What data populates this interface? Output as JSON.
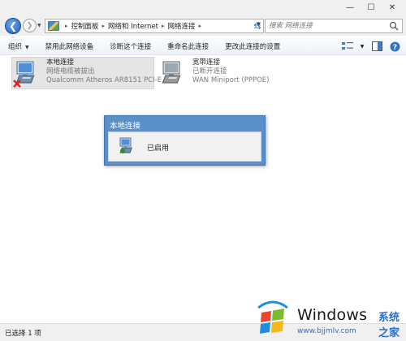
{
  "window": {
    "controls": {
      "minimize": "—",
      "maximize": "☐",
      "close": "✕"
    }
  },
  "navigation": {
    "back_icon": "back-arrow-icon",
    "forward_icon": "forward-arrow-icon",
    "breadcrumbs": [
      "控制面板",
      "网络和 Internet",
      "网络连接"
    ],
    "search_placeholder": "搜索 网络连接"
  },
  "toolbar": {
    "items": [
      "组织",
      "禁用此网络设备",
      "诊断这个连接",
      "重命名此连接",
      "更改此连接的设置"
    ],
    "organize_label": "组织",
    "disable_label": "禁用此网络设备",
    "diagnose_label": "诊断这个连接",
    "rename_label": "重命名此连接",
    "change_label": "更改此连接的设置"
  },
  "connections": [
    {
      "name": "本地连接",
      "status": "网络电缆被拔出",
      "device": "Qualcomm Atheros AR8151 PCI-E...",
      "selected": true,
      "disconnected": true
    },
    {
      "name": "宽带连接",
      "status": "已断开连接",
      "device": "WAN Miniport (PPPOE)",
      "selected": false,
      "disconnected": false
    }
  ],
  "popup": {
    "title": "本地连接",
    "status": "已启用"
  },
  "statusbar": {
    "text": "已选择 1 项"
  },
  "watermark": {
    "brand": "Windows",
    "site_name": "系统之家",
    "url": "www.bjjmlv.com",
    "colors": {
      "red": "#e8462b",
      "green": "#7cbb2f",
      "blue": "#1e8ee0",
      "yellow": "#f6b71c"
    }
  },
  "colors": {
    "popup_header": "#5b8fc9",
    "selection": "#e5e5e5",
    "error_x": "#e02020"
  }
}
